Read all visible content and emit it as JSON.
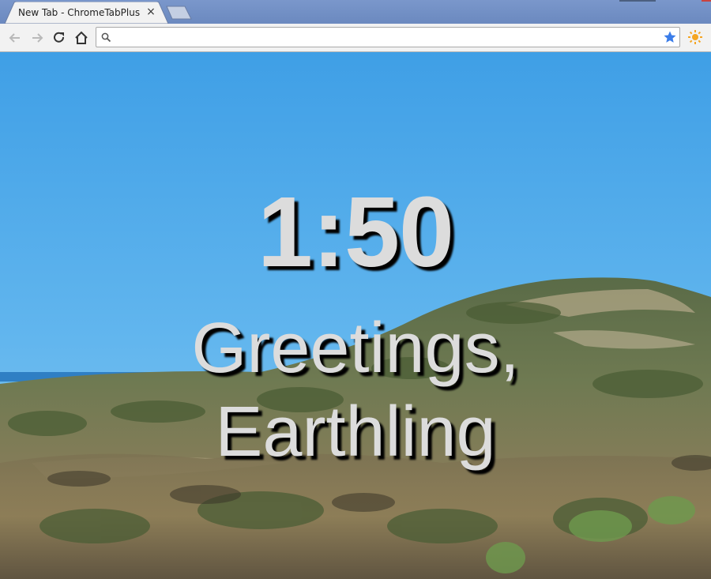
{
  "browser": {
    "tab_title": "New Tab - ChromeTabPlus",
    "tab_close_glyph": "×",
    "icons": {
      "back": "back-arrow-icon",
      "forward": "forward-arrow-icon",
      "reload": "reload-icon",
      "home": "home-icon",
      "search": "search-icon",
      "bookmark": "star-icon",
      "extension": "sun-icon"
    },
    "omnibox": {
      "value": "",
      "placeholder": ""
    },
    "colors": {
      "bookmark_star": "#3b7de9",
      "extension_sun": "#f5a623",
      "tabstrip": "#6f8fc4"
    }
  },
  "newtab": {
    "clock": "1:50",
    "greeting_line1": "Greetings,",
    "greeting_line2": "Earthling",
    "colors": {
      "text": "#dcdcdc",
      "shadow": "#000000"
    }
  }
}
